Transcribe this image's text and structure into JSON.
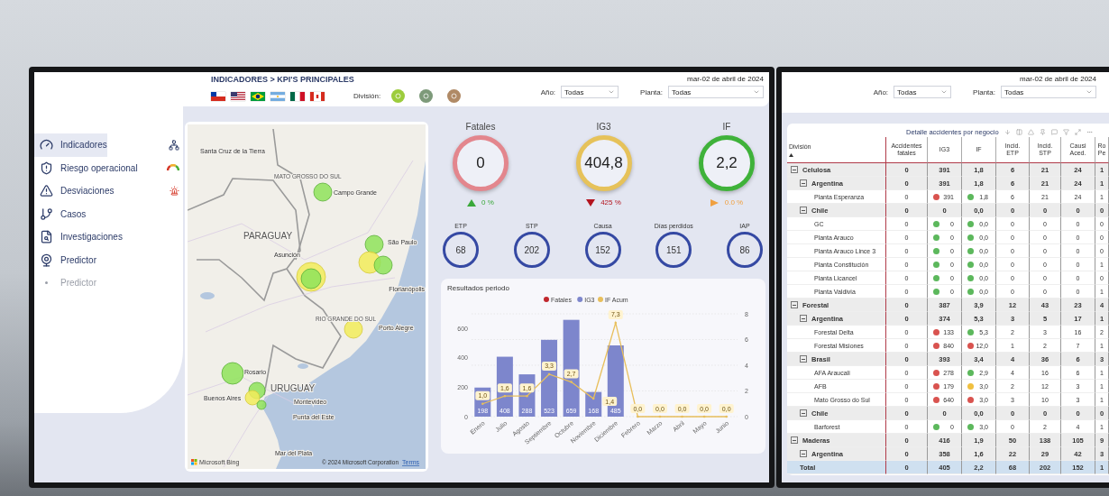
{
  "left_screen": {
    "header": {
      "title": "INDICADORES > KPI'S PRINCIPALES",
      "division_label": "División:",
      "date": "mar-02 de abril de 2024",
      "filters": [
        {
          "label": "Año:",
          "value": "Todas"
        },
        {
          "label": "Planta:",
          "value": "Todas"
        }
      ]
    },
    "sidebar": {
      "items": [
        {
          "label": "Indicadores",
          "selected": true,
          "disabled": false
        },
        {
          "label": "Riesgo operacional",
          "selected": false,
          "disabled": false
        },
        {
          "label": "Desviaciones",
          "selected": false,
          "disabled": false
        },
        {
          "label": "Casos",
          "selected": false,
          "disabled": false
        },
        {
          "label": "Investigaciones",
          "selected": false,
          "disabled": false
        },
        {
          "label": "Predictor",
          "selected": false,
          "disabled": false
        },
        {
          "label": "Predictor",
          "selected": false,
          "disabled": true
        }
      ]
    },
    "map": {
      "labels": [
        {
          "text": "Santa Cruz de la Tierra",
          "kind": "city"
        },
        {
          "text": "MATO GROSSO DO SUL",
          "kind": "region"
        },
        {
          "text": "Campo Grande",
          "kind": "city"
        },
        {
          "text": "PARAGUAY",
          "kind": "country"
        },
        {
          "text": "Asunción",
          "kind": "city"
        },
        {
          "text": "São Paulo",
          "kind": "city"
        },
        {
          "text": "Florianópolis",
          "kind": "city"
        },
        {
          "text": "RIO GRANDE DO SUL",
          "kind": "region"
        },
        {
          "text": "Porto Alegre",
          "kind": "city"
        },
        {
          "text": "Rosario",
          "kind": "city"
        },
        {
          "text": "URUGUAY",
          "kind": "country"
        },
        {
          "text": "Buenos Aires",
          "kind": "city"
        },
        {
          "text": "Montevideo",
          "kind": "city"
        },
        {
          "text": "Punta del Este",
          "kind": "city"
        },
        {
          "text": "Mar del Plata",
          "kind": "city"
        }
      ],
      "provider": "Microsoft Bing",
      "attribution": "© 2024 Microsoft Corporation",
      "terms_link": "Terms"
    },
    "kpis": [
      {
        "label": "Fatales",
        "value": "0",
        "color": "#e3868d",
        "kind": "up",
        "change": "0 %"
      },
      {
        "label": "IG3",
        "value": "404,8",
        "color": "#e6c25a",
        "kind": "down",
        "change": "425 %"
      },
      {
        "label": "IF",
        "value": "2,2",
        "color": "#3fb23a",
        "kind": "flat",
        "change": "0.0 %"
      }
    ],
    "small_kpis": [
      {
        "label": "ETP",
        "value": "68"
      },
      {
        "label": "STP",
        "value": "202"
      },
      {
        "label": "Causa",
        "value": "152"
      },
      {
        "label": "Días perdidos",
        "value": "151"
      },
      {
        "label": "IAP",
        "value": "86"
      }
    ],
    "chart_panel": {
      "title": "Resultados periodo",
      "chart_data": {
        "type": "bar",
        "legend": "top",
        "grid": true,
        "categories": [
          "Enero",
          "Julio",
          "Agosto",
          "Septiembre",
          "Octubre",
          "Noviembre",
          "Diciembre",
          "Febrero",
          "Marzo",
          "Abril",
          "Mayo",
          "Junio"
        ],
        "series": [
          {
            "name": "Fatales",
            "type": "bar",
            "color": "#c0272d",
            "values": [
              0,
              0,
              0,
              0,
              0,
              0,
              0,
              0,
              0,
              0,
              0,
              0
            ],
            "value_labels": [
              null,
              null,
              null,
              null,
              null,
              null,
              null,
              null,
              null,
              null,
              null,
              null
            ]
          },
          {
            "name": "IG3",
            "type": "bar",
            "color": "#7d86cc",
            "values": [
              198,
              408,
              288,
              523,
              659,
              168,
              485,
              null,
              null,
              null,
              null,
              null
            ],
            "value_labels": [
              "198",
              "408",
              "288",
              "523",
              "659",
              "168",
              "485",
              null,
              null,
              null,
              null,
              null
            ]
          },
          {
            "name": "IF Acum",
            "type": "line",
            "axis": "y2",
            "color": "#e8bf5c",
            "values": [
              1.0,
              1.6,
              1.6,
              3.3,
              2.7,
              1.4,
              7.3,
              0,
              0,
              0,
              0,
              0
            ],
            "value_labels": [
              "1,0",
              "1,6",
              "1,6",
              "3,3",
              "2,7",
              "1,4",
              "7,3",
              "0,0",
              "0,0",
              "0,0",
              "0,0",
              "0,0"
            ]
          }
        ],
        "ylim": [
          0,
          700
        ],
        "yticks": [
          0,
          200,
          400,
          600
        ],
        "y2lim": [
          0,
          8
        ],
        "y2ticks": [
          0,
          2,
          4,
          6,
          8
        ]
      }
    }
  },
  "right_screen": {
    "date": "mar-02 de abril de 2024",
    "filters": [
      {
        "label": "Año:",
        "value": "Todas"
      },
      {
        "label": "Planta:",
        "value": "Todas"
      }
    ],
    "table": {
      "title": "Detalle accidentes por negocio",
      "columns": [
        "División",
        "Accidentes fatales",
        "IG3",
        "IF",
        "Incid. ETP",
        "Incid. STP",
        "Causi Aced.",
        "Ro Pe"
      ],
      "rows": [
        {
          "expanded": true,
          "cells": [
            "Celulosa",
            "0",
            "391",
            "1,8",
            "6",
            "21",
            "24",
            "1"
          ],
          "children": [
            {
              "expanded": true,
              "cells": [
                "Argentina",
                "0",
                "391",
                "1,8",
                "6",
                "21",
                "24",
                "1"
              ],
              "children": [
                {
                  "cells": [
                    "Planta Esperanza",
                    "0",
                    {
                      "value": "391",
                      "color": "#d9534f"
                    },
                    {
                      "value": "1,8",
                      "color": "#5cb85c"
                    },
                    "6",
                    "21",
                    "24",
                    "1"
                  ]
                }
              ]
            },
            {
              "expanded": true,
              "cells": [
                "Chile",
                "0",
                "0",
                "0,0",
                "0",
                "0",
                "0",
                "0"
              ],
              "children": [
                {
                  "cells": [
                    "GC",
                    "0",
                    {
                      "value": "0",
                      "color": "#5cb85c"
                    },
                    {
                      "value": "0,0",
                      "color": "#5cb85c"
                    },
                    "0",
                    "0",
                    "0",
                    "0"
                  ]
                },
                {
                  "cells": [
                    "Planta Arauco",
                    "0",
                    {
                      "value": "0",
                      "color": "#5cb85c"
                    },
                    {
                      "value": "0,0",
                      "color": "#5cb85c"
                    },
                    "0",
                    "0",
                    "0",
                    "0"
                  ]
                },
                {
                  "cells": [
                    "Planta Arauco Lince 3",
                    "0",
                    {
                      "value": "0",
                      "color": "#5cb85c"
                    },
                    {
                      "value": "0,0",
                      "color": "#5cb85c"
                    },
                    "0",
                    "0",
                    "0",
                    "0"
                  ]
                },
                {
                  "cells": [
                    "Planta Constitución",
                    "0",
                    {
                      "value": "0",
                      "color": "#5cb85c"
                    },
                    {
                      "value": "0,0",
                      "color": "#5cb85c"
                    },
                    "0",
                    "0",
                    "0",
                    "1"
                  ]
                },
                {
                  "cells": [
                    "Planta Licancel",
                    "0",
                    {
                      "value": "0",
                      "color": "#5cb85c"
                    },
                    {
                      "value": "0,0",
                      "color": "#5cb85c"
                    },
                    "0",
                    "0",
                    "0",
                    "0"
                  ]
                },
                {
                  "cells": [
                    "Planta Valdivia",
                    "0",
                    {
                      "value": "0",
                      "color": "#5cb85c"
                    },
                    {
                      "value": "0,0",
                      "color": "#5cb85c"
                    },
                    "0",
                    "0",
                    "0",
                    "1"
                  ]
                }
              ]
            }
          ]
        },
        {
          "expanded": true,
          "cells": [
            "Forestal",
            "0",
            "387",
            "3,9",
            "12",
            "43",
            "23",
            "4"
          ],
          "children": [
            {
              "expanded": true,
              "cells": [
                "Argentina",
                "0",
                "374",
                "5,3",
                "3",
                "5",
                "17",
                "1"
              ],
              "children": [
                {
                  "cells": [
                    "Forestal Delta",
                    "0",
                    {
                      "value": "133",
                      "color": "#d9534f"
                    },
                    {
                      "value": "5,3",
                      "color": "#5cb85c"
                    },
                    "2",
                    "3",
                    "16",
                    "2"
                  ]
                },
                {
                  "cells": [
                    "Forestal Misiones",
                    "0",
                    {
                      "value": "840",
                      "color": "#d9534f"
                    },
                    {
                      "value": "12,0",
                      "color": "#d9534f"
                    },
                    "1",
                    "2",
                    "7",
                    "1"
                  ]
                }
              ]
            },
            {
              "expanded": true,
              "cells": [
                "Brasil",
                "0",
                "393",
                "3,4",
                "4",
                "36",
                "6",
                "3"
              ],
              "children": [
                {
                  "cells": [
                    "AFA Araucali",
                    "0",
                    {
                      "value": "278",
                      "color": "#d9534f"
                    },
                    {
                      "value": "2,9",
                      "color": "#5cb85c"
                    },
                    "4",
                    "16",
                    "6",
                    "1"
                  ]
                },
                {
                  "cells": [
                    "AFB",
                    "0",
                    {
                      "value": "179",
                      "color": "#d9534f"
                    },
                    {
                      "value": "3,0",
                      "color": "#f0c040"
                    },
                    "2",
                    "12",
                    "3",
                    "1"
                  ]
                },
                {
                  "cells": [
                    "Mato Grosso do Sul",
                    "0",
                    {
                      "value": "640",
                      "color": "#d9534f"
                    },
                    {
                      "value": "3,0",
                      "color": "#d9534f"
                    },
                    "3",
                    "10",
                    "3",
                    "1"
                  ]
                }
              ]
            },
            {
              "expanded": true,
              "cells": [
                "Chile",
                "0",
                "0",
                "0,0",
                "0",
                "0",
                "0",
                "0"
              ],
              "children": [
                {
                  "cells": [
                    "Barforest",
                    "0",
                    {
                      "value": "0",
                      "color": "#5cb85c"
                    },
                    {
                      "value": "3,0",
                      "color": "#5cb85c"
                    },
                    "0",
                    "2",
                    "4",
                    "1"
                  ]
                }
              ]
            }
          ]
        },
        {
          "expanded": true,
          "cells": [
            "Maderas",
            "0",
            "416",
            "1,9",
            "50",
            "138",
            "105",
            "9"
          ],
          "children": [
            {
              "expanded": true,
              "cells": [
                "Argentina",
                "0",
                "358",
                "1,6",
                "22",
                "29",
                "42",
                "3"
              ]
            }
          ]
        }
      ],
      "total": {
        "cells": [
          "Total",
          "0",
          "405",
          "2,2",
          "68",
          "202",
          "152",
          "1"
        ]
      }
    }
  }
}
